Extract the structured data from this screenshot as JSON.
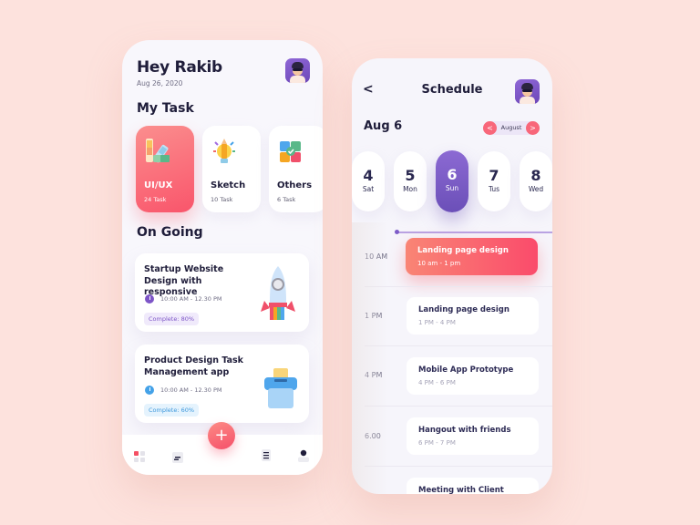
{
  "home": {
    "greeting": "Hey Rakib",
    "date": "Aug 26, 2020",
    "my_task_title": "My Task",
    "categories": [
      {
        "name": "UI/UX",
        "count": "24 Task",
        "icon": "color-palette-icon",
        "active": true
      },
      {
        "name": "Sketch",
        "count": "10 Task",
        "icon": "lightbulb-pencil-icon",
        "active": false
      },
      {
        "name": "Others",
        "count": "6 Task",
        "icon": "puzzle-icon",
        "active": false
      }
    ],
    "ongoing_title": "On Going",
    "tasks": [
      {
        "title": "Startup Website Design with responsive",
        "time": "10:00 AM - 12.30 PM",
        "progress_label": "Complete: 80%",
        "progress": 80,
        "icon": "rocket-icon"
      },
      {
        "title": "Product Design Task Management app",
        "time": "10:00 AM - 12.30 PM",
        "progress_label": "Complete: 60%",
        "progress": 60,
        "icon": "inbox-box-icon"
      }
    ],
    "fab_label": "+",
    "nav": [
      "dashboard-icon",
      "calendar-icon",
      "add-icon",
      "list-icon",
      "profile-icon"
    ]
  },
  "schedule": {
    "back_label": "<",
    "title": "Schedule",
    "current_date": "Aug 6",
    "month": "August",
    "prev_month": "<",
    "next_month": ">",
    "days": [
      {
        "num": "4",
        "name": "Sat"
      },
      {
        "num": "5",
        "name": "Mon"
      },
      {
        "num": "6",
        "name": "Sun",
        "active": true
      },
      {
        "num": "7",
        "name": "Tus"
      },
      {
        "num": "8",
        "name": "Wed"
      }
    ],
    "slots": [
      {
        "time": "10 AM",
        "title": "Landing page design",
        "range": "10 am - 1 pm",
        "active": true
      },
      {
        "time": "1 PM",
        "title": "Landing page design",
        "range": "1 PM - 4 PM"
      },
      {
        "time": "4 PM",
        "title": "Mobile App Prototype",
        "range": "4 PM - 6 PM"
      },
      {
        "time": "6.00",
        "title": "Hangout with friends",
        "range": "6 PM - 7 PM"
      },
      {
        "time": "",
        "title": "Meeting with Client",
        "range": ""
      }
    ]
  },
  "colors": {
    "background": "#fde2dd",
    "accent_red": "#f9556b",
    "accent_purple": "#7d55c7",
    "accent_blue": "#44a2e8",
    "text_dark": "#1f1d3a"
  }
}
